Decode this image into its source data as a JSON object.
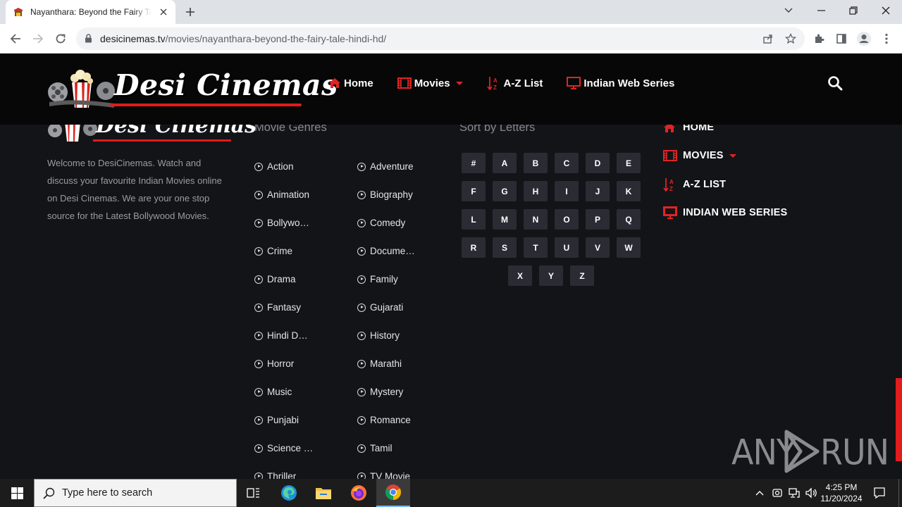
{
  "browser": {
    "tab_title": "Nayanthara: Beyond the Fairy Tale Hindi HD",
    "url_host": "desicinemas.tv",
    "url_path": "/movies/nayanthara-beyond-the-fairy-tale-hindi-hd/"
  },
  "header": {
    "logo_text": "Desi Cinemas",
    "nav": [
      {
        "label": "Home",
        "icon": "home-icon"
      },
      {
        "label": "Movies",
        "icon": "film-icon"
      },
      {
        "label": "A-Z List",
        "icon": "sort-az-icon"
      },
      {
        "label": "Indian Web Series",
        "icon": "tv-icon"
      }
    ]
  },
  "footer": {
    "logo_text": "Desi Cinemas",
    "about": "Welcome to DesiCinemas. Watch and discuss your favourite Indian Movies online on Desi Cinemas. We are your one stop source for the Latest Bollywood Movies.",
    "genres_title": "Movie Genres",
    "genres": [
      "Action",
      "Adventure",
      "Animation",
      "Biography",
      "Bollywo…",
      "Comedy",
      "Crime",
      "Docume…",
      "Drama",
      "Family",
      "Fantasy",
      "Gujarati",
      "Hindi D…",
      "History",
      "Horror",
      "Marathi",
      "Music",
      "Mystery",
      "Punjabi",
      "Romance",
      "Science …",
      "Tamil",
      "Thriller",
      "TV Movie"
    ],
    "letters_title": "Sort by Letters",
    "letters": [
      "#",
      "A",
      "B",
      "C",
      "D",
      "E",
      "F",
      "G",
      "H",
      "I",
      "J",
      "K",
      "L",
      "M",
      "N",
      "O",
      "P",
      "Q",
      "R",
      "S",
      "T",
      "U",
      "V",
      "W",
      "X",
      "Y",
      "Z"
    ],
    "menu": [
      {
        "label": "HOME",
        "icon": "home-icon"
      },
      {
        "label": "MOVIES",
        "icon": "film-icon"
      },
      {
        "label": "A-Z LIST",
        "icon": "sort-az-icon"
      },
      {
        "label": "INDIAN WEB SERIES",
        "icon": "tv-icon"
      }
    ]
  },
  "watermark": {
    "left": "ANY",
    "right": "RUN"
  },
  "taskbar": {
    "search_placeholder": "Type here to search",
    "time": "4:25 PM",
    "date": "11/20/2024"
  },
  "colors": {
    "accent_red": "#e02424",
    "header_bg": "#070707",
    "footer_bg": "#131418",
    "letter_bg": "#2b2c33"
  }
}
